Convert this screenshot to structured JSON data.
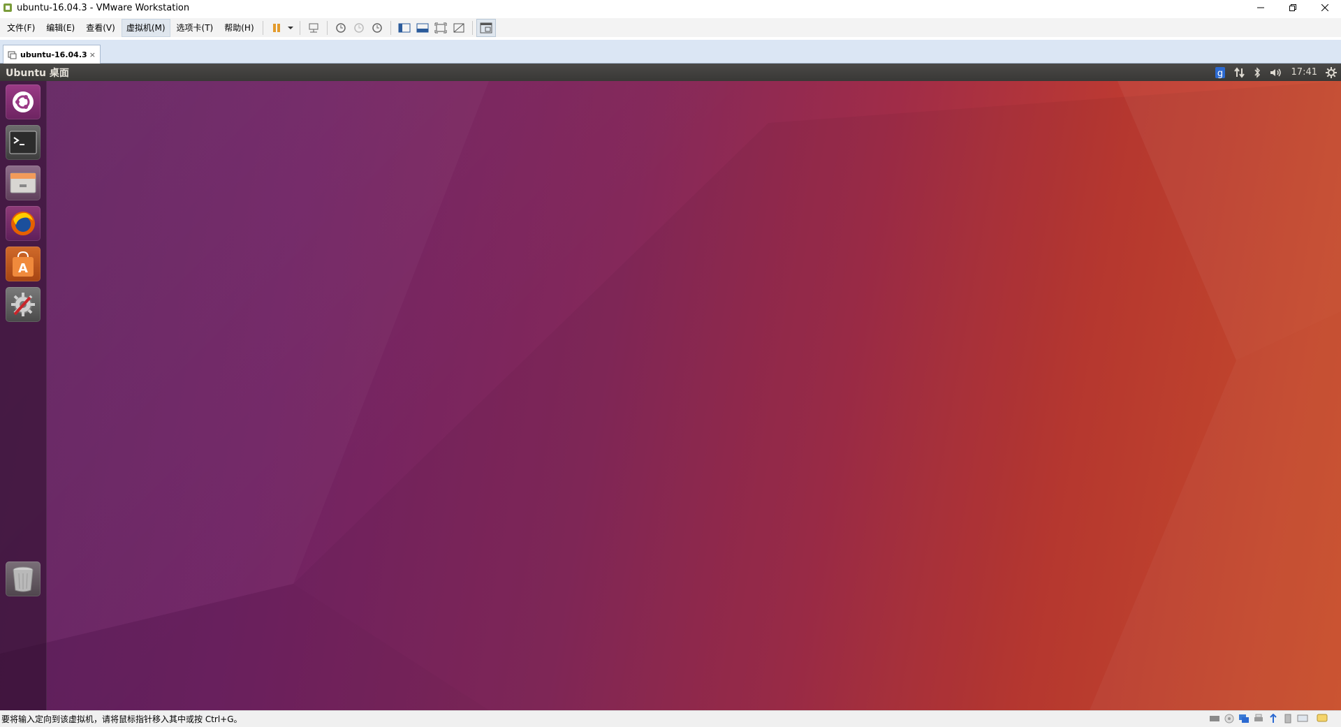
{
  "window": {
    "title": "ubuntu-16.04.3 - VMware Workstation"
  },
  "menu": {
    "items": [
      "文件(F)",
      "编辑(E)",
      "查看(V)",
      "虚拟机(M)",
      "选项卡(T)",
      "帮助(H)"
    ],
    "active_index": 3
  },
  "tab": {
    "label": "ubuntu-16.04.3",
    "close": "×"
  },
  "ubuntu_panel": {
    "title": "Ubuntu 桌面",
    "clock": "17:41"
  },
  "launcher": {
    "items": [
      "dash-home",
      "terminal",
      "files",
      "firefox",
      "software-center",
      "system-settings",
      "trash"
    ]
  },
  "statusbar": {
    "text": "要将输入定向到该虚拟机，请将鼠标指针移入其中或按 Ctrl+G。"
  },
  "colors": {
    "accent": "#dfe6ee",
    "panel": "#3c3b37",
    "wallpaper_left": "#5e1f5e",
    "wallpaper_right": "#d2522c"
  }
}
